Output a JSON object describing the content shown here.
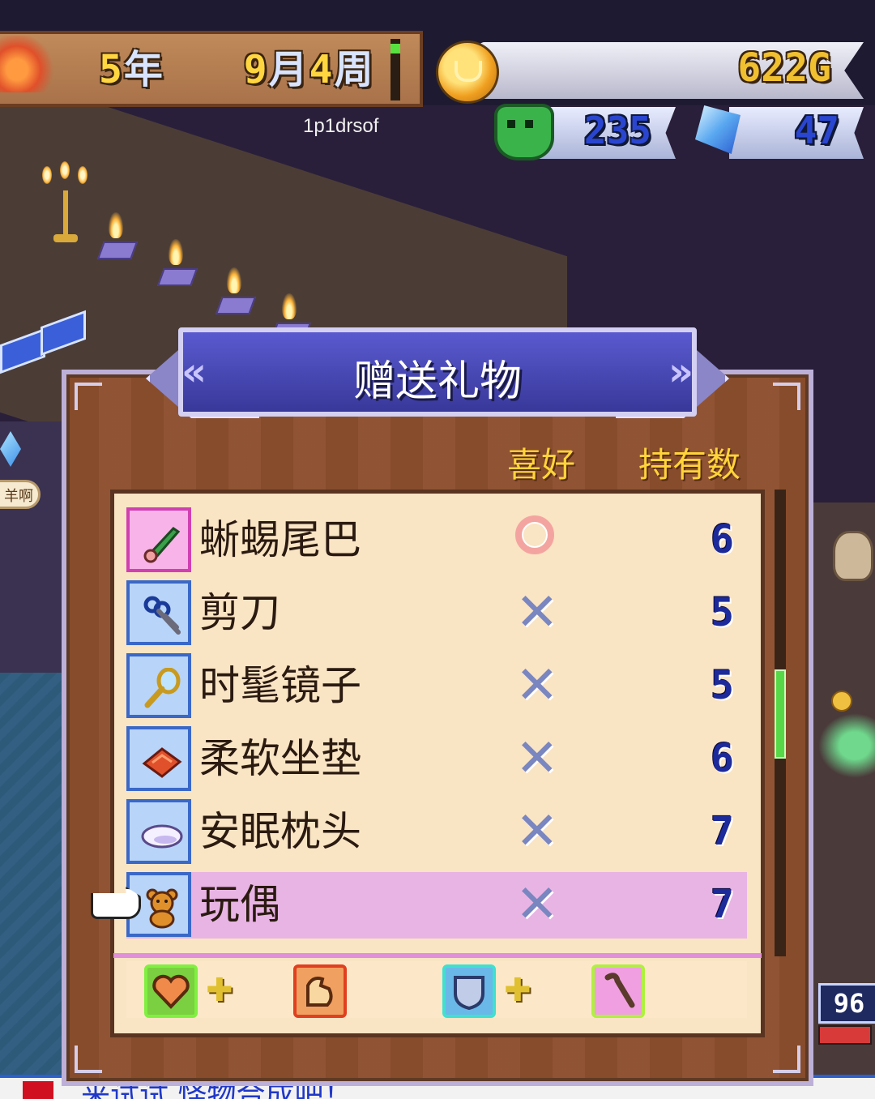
{
  "hud": {
    "date": {
      "year": "5",
      "year_unit": "年",
      "month": "9",
      "month_unit": "月",
      "week": "4",
      "week_unit": "周"
    },
    "player_name": "1p1drsof",
    "gold": "622G",
    "monster_count": "235",
    "crystal_count": "47"
  },
  "dialog": {
    "title": "赠送礼物",
    "columns": {
      "preference": "喜好",
      "owned": "持有数"
    },
    "items": [
      {
        "name": "蜥蜴尾巴",
        "preference": "liked",
        "count": "6",
        "icon": "lizard-tail-icon"
      },
      {
        "name": "剪刀",
        "preference": "disliked",
        "count": "5",
        "icon": "scissors-icon"
      },
      {
        "name": "时髦镜子",
        "preference": "disliked",
        "count": "5",
        "icon": "mirror-icon"
      },
      {
        "name": "柔软坐垫",
        "preference": "disliked",
        "count": "6",
        "icon": "cushion-icon"
      },
      {
        "name": "安眠枕头",
        "preference": "disliked",
        "count": "7",
        "icon": "pillow-icon"
      },
      {
        "name": "玩偶",
        "preference": "disliked",
        "count": "7",
        "icon": "teddy-bear-icon",
        "selected": true
      }
    ],
    "stat_icons": [
      "heart-icon",
      "muscle-icon",
      "shield-icon",
      "staff-icon"
    ],
    "pref_symbols": {
      "liked": "○",
      "disliked": "✕"
    },
    "plus": "✚"
  },
  "background": {
    "left_speech": "羊啊",
    "badge_number": "96",
    "bottom_message": "来试试 怪物合成吧！"
  },
  "colors": {
    "accent_yellow": "#ffd43a",
    "list_bg": "#f9e4c4",
    "selected_row": "#e8b4e4",
    "banner_blue": "#4848b8"
  }
}
